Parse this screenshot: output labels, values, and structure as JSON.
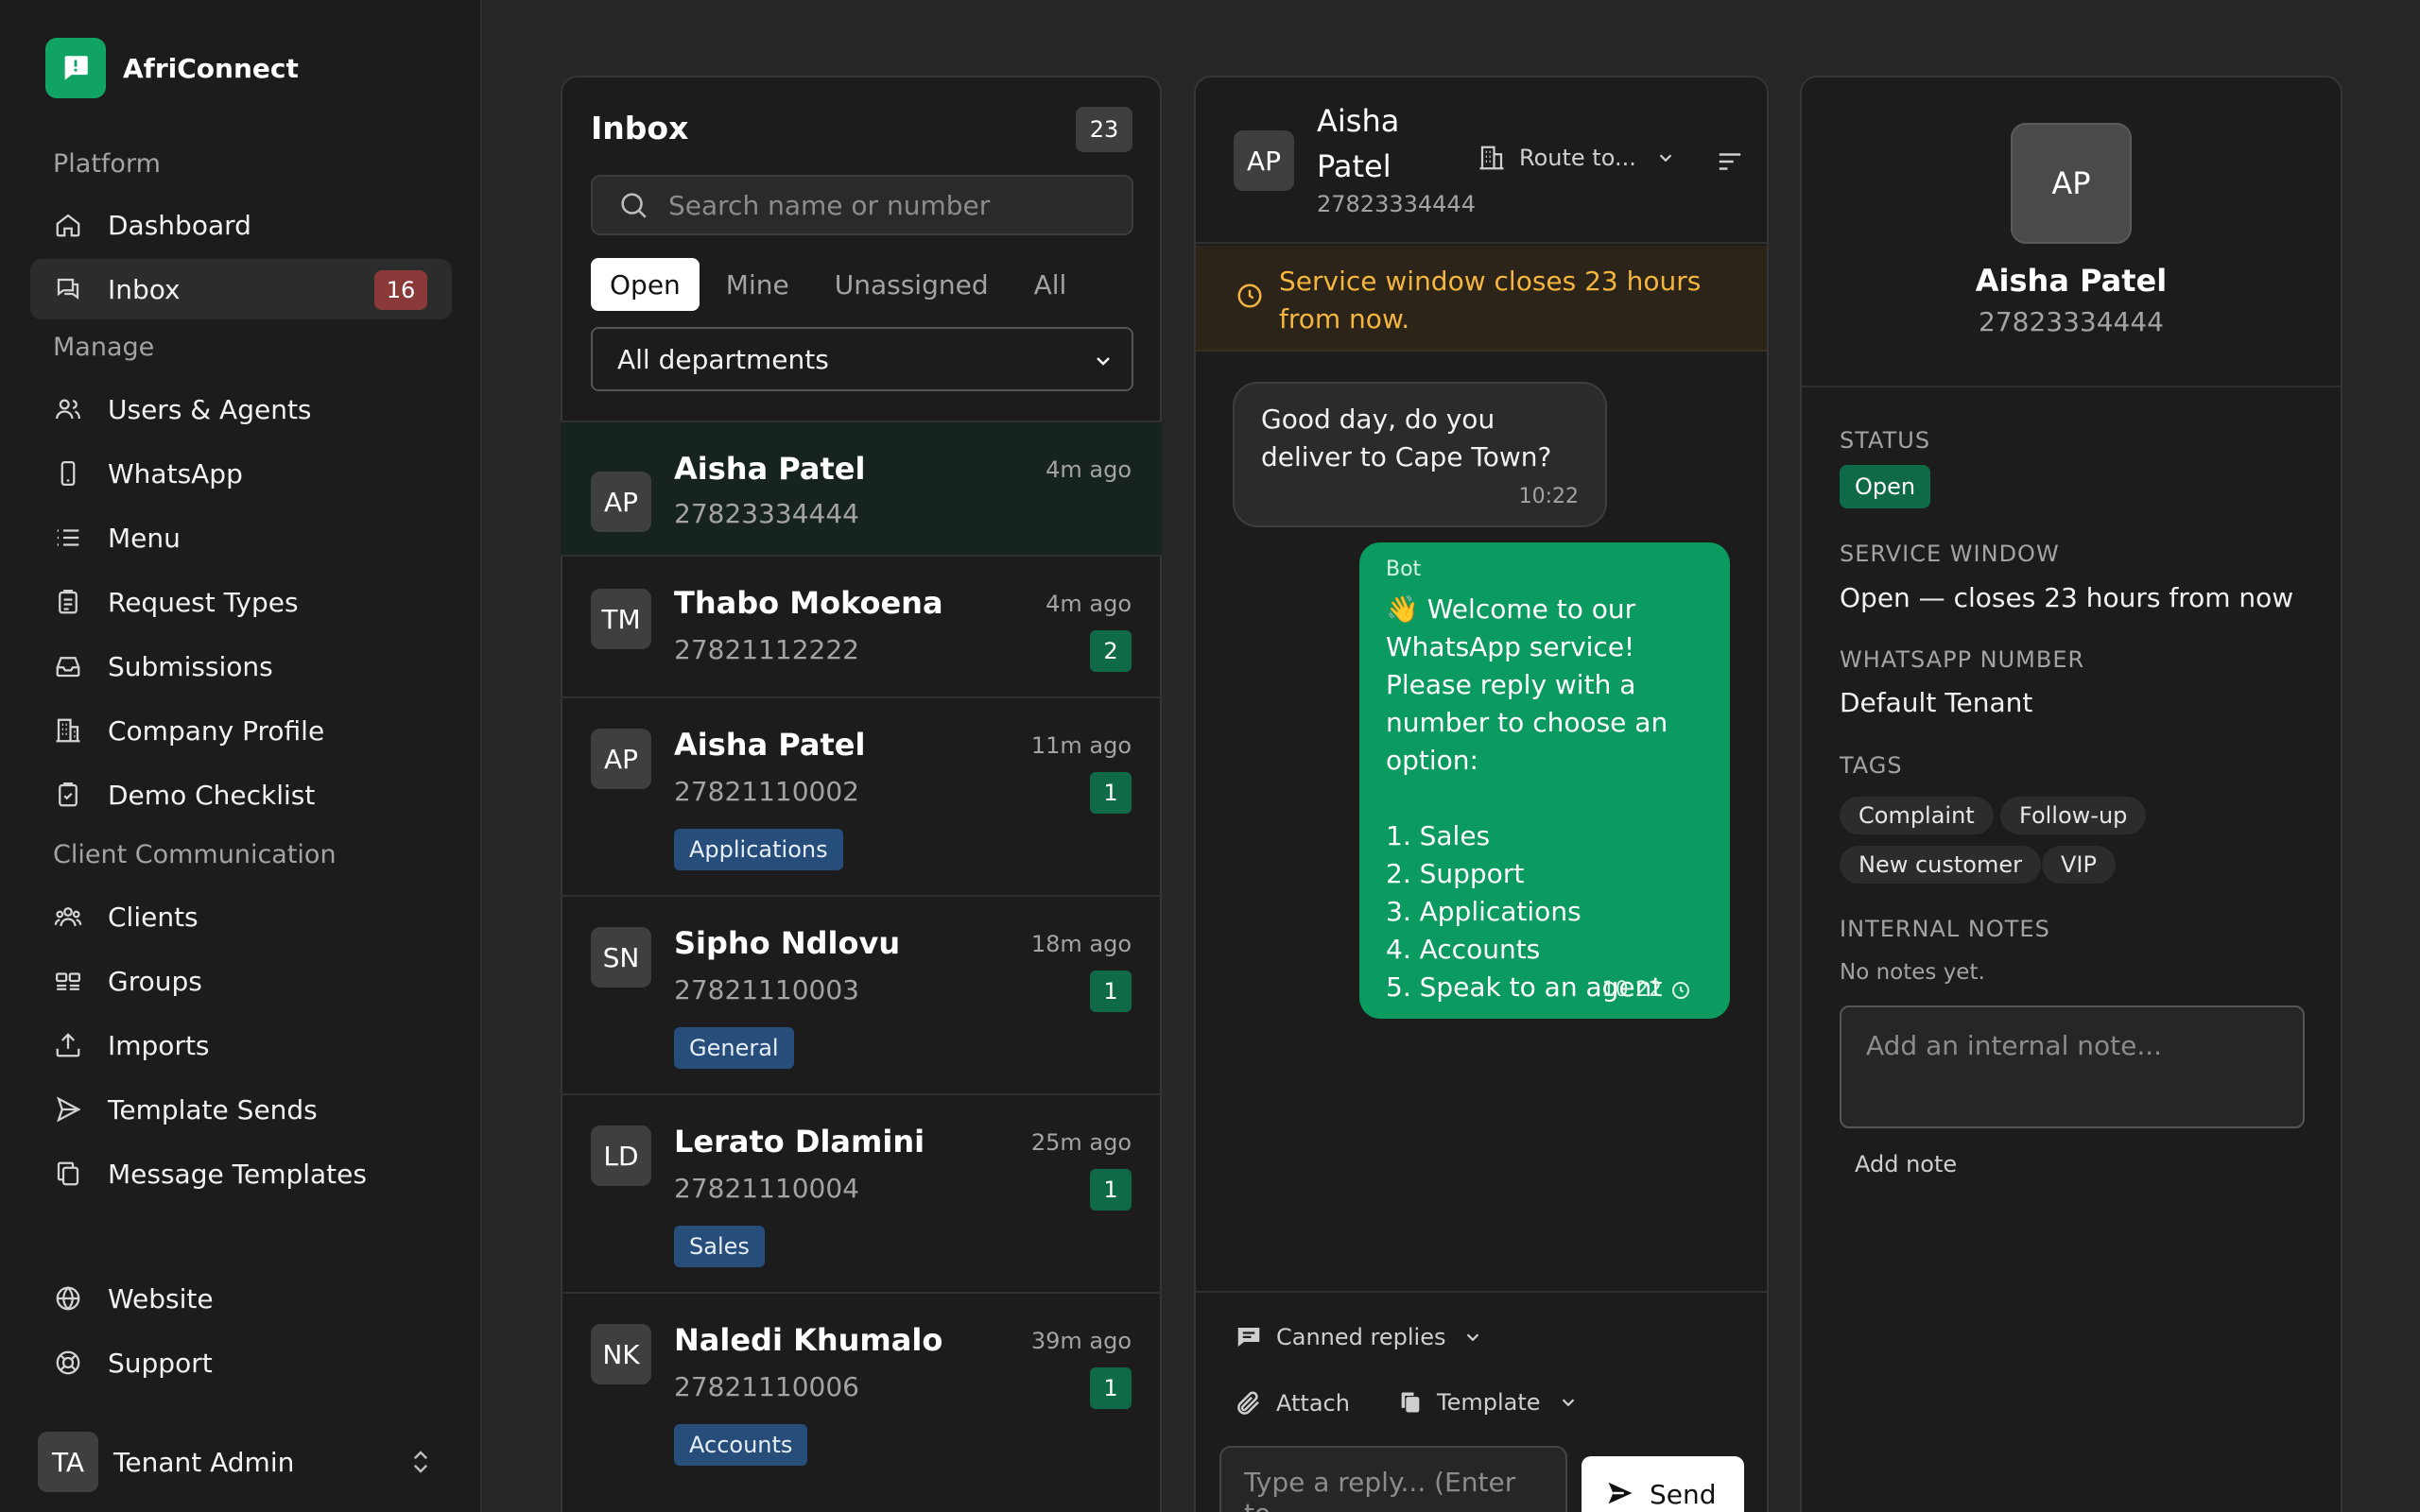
{
  "brand": {
    "name": "AfriConnect",
    "color": "#10a364"
  },
  "sidebar": {
    "sections": {
      "platform": "Platform",
      "manage": "Manage",
      "client_comm": "Client Communication"
    },
    "items": [
      {
        "label": "Dashboard",
        "icon": "home-icon"
      },
      {
        "label": "Inbox",
        "icon": "chat-icon",
        "badge": "16",
        "active": true
      },
      {
        "label": "Users & Agents",
        "icon": "users-icon"
      },
      {
        "label": "WhatsApp",
        "icon": "phone-icon"
      },
      {
        "label": "Menu",
        "icon": "list-icon"
      },
      {
        "label": "Request Types",
        "icon": "clipboard-icon"
      },
      {
        "label": "Submissions",
        "icon": "inbox-tray-icon"
      },
      {
        "label": "Company Profile",
        "icon": "building-icon"
      },
      {
        "label": "Demo Checklist",
        "icon": "checklist-icon"
      },
      {
        "label": "Clients",
        "icon": "clients-icon"
      },
      {
        "label": "Groups",
        "icon": "groups-icon"
      },
      {
        "label": "Imports",
        "icon": "upload-icon"
      },
      {
        "label": "Template Sends",
        "icon": "send-icon"
      },
      {
        "label": "Message Templates",
        "icon": "copy-icon"
      },
      {
        "label": "Website",
        "icon": "globe-icon"
      },
      {
        "label": "Support",
        "icon": "lifebuoy-icon"
      }
    ],
    "user": {
      "initials": "TA",
      "name": "Tenant Admin"
    }
  },
  "inbox": {
    "title": "Inbox",
    "count": "23",
    "search_placeholder": "Search name or number",
    "tabs": [
      "Open",
      "Mine",
      "Unassigned",
      "All"
    ],
    "active_tab": "Open",
    "department": "All departments",
    "conversations": [
      {
        "initials": "AP",
        "name": "Aisha Patel",
        "phone": "27823334444",
        "time": "4m ago",
        "unread": "",
        "tag": "",
        "selected": true
      },
      {
        "initials": "TM",
        "name": "Thabo Mokoena",
        "phone": "27821112222",
        "time": "4m ago",
        "unread": "2",
        "tag": ""
      },
      {
        "initials": "AP",
        "name": "Aisha Patel",
        "phone": "27821110002",
        "time": "11m ago",
        "unread": "1",
        "tag": "Applications"
      },
      {
        "initials": "SN",
        "name": "Sipho Ndlovu",
        "phone": "27821110003",
        "time": "18m ago",
        "unread": "1",
        "tag": "General"
      },
      {
        "initials": "LD",
        "name": "Lerato Dlamini",
        "phone": "27821110004",
        "time": "25m ago",
        "unread": "1",
        "tag": "Sales"
      },
      {
        "initials": "NK",
        "name": "Naledi Khumalo",
        "phone": "27821110006",
        "time": "39m ago",
        "unread": "1",
        "tag": "Accounts"
      }
    ]
  },
  "chat": {
    "initials": "AP",
    "name": "Aisha Patel",
    "phone": "27823334444",
    "route_label": "Route to...",
    "service_banner": "Service window closes 23 hours from now.",
    "messages": [
      {
        "direction": "in",
        "text": "Good day, do you deliver to Cape Town?",
        "time": "10:22"
      },
      {
        "direction": "out",
        "sender": "Bot",
        "text": "👋 Welcome to our WhatsApp service! Please reply with a number to choose an option:\n\n1. Sales\n2. Support\n3. Applications\n4. Accounts\n5. Speak to an agent",
        "time": "10:22"
      }
    ],
    "composer": {
      "canned": "Canned replies",
      "attach": "Attach",
      "template": "Template",
      "placeholder": "Type a reply... (Enter to",
      "send": "Send"
    }
  },
  "contact": {
    "initials": "AP",
    "name": "Aisha Patel",
    "phone": "27823334444",
    "status_label": "STATUS",
    "status": "Open",
    "service_window_label": "SERVICE WINDOW",
    "service_window": "Open — closes 23 hours from now",
    "whatsapp_label": "WHATSAPP NUMBER",
    "whatsapp_number": "Default Tenant",
    "tags_label": "TAGS",
    "tags": [
      "Complaint",
      "Follow-up",
      "New customer",
      "VIP"
    ],
    "notes_label": "INTERNAL NOTES",
    "notes_empty": "No notes yet.",
    "note_placeholder": "Add an internal note...",
    "add_note": "Add note"
  },
  "colors": {
    "accent": "#0b9a5f",
    "badge_red": "#8b3a3a",
    "tag_blue": "#274d7a",
    "warning": "#f4b63e"
  }
}
